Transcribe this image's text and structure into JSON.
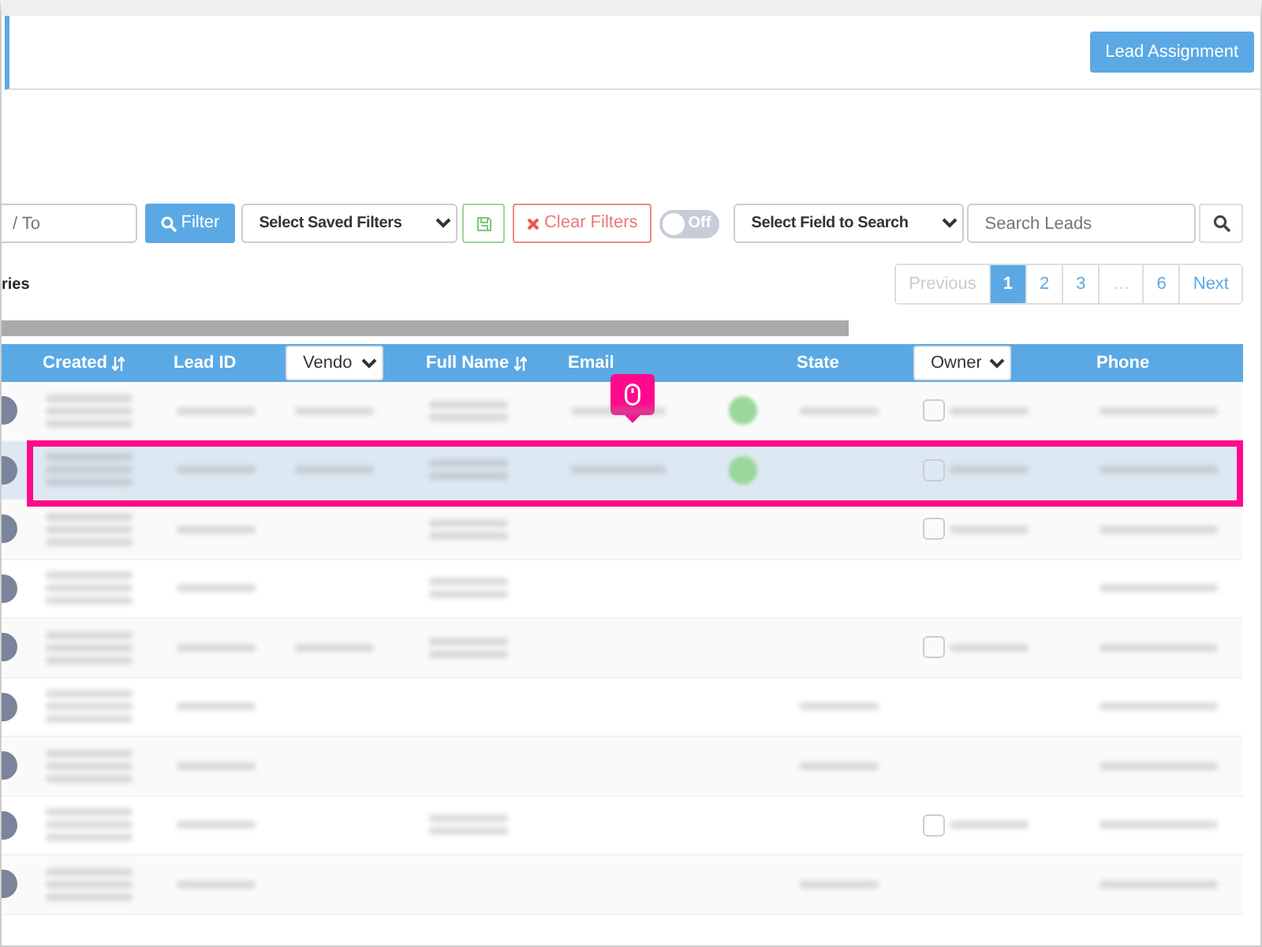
{
  "header": {
    "button": "Lead Assignment"
  },
  "filters": {
    "date_to": {
      "placeholder": "/ To"
    },
    "filter_button": "Filter",
    "saved_filters": "Select Saved Filters",
    "clear_button": "Clear Filters",
    "toggle": {
      "label": "Off",
      "on": false
    },
    "search_field": "Select Field to Search",
    "search": {
      "placeholder": "Search Leads"
    }
  },
  "entries_text": "ries",
  "pagination": [
    {
      "label": "Previous",
      "selected": false,
      "disabled": true
    },
    {
      "label": "1",
      "selected": true,
      "disabled": false
    },
    {
      "label": "2",
      "selected": false,
      "disabled": false
    },
    {
      "label": "3",
      "selected": false,
      "disabled": false
    },
    {
      "label": "…",
      "selected": false,
      "disabled": true
    },
    {
      "label": "6",
      "selected": false,
      "disabled": false
    },
    {
      "label": "Next",
      "selected": false,
      "disabled": false
    }
  ],
  "table": {
    "columns": [
      {
        "kind": "text",
        "label": "Created",
        "sortable": true
      },
      {
        "kind": "text",
        "label": "Lead ID",
        "sortable": false
      },
      {
        "kind": "select",
        "label": "Vendo"
      },
      {
        "kind": "text",
        "label": "Full Name",
        "sortable": true
      },
      {
        "kind": "text",
        "label": "Email",
        "sortable": false
      },
      {
        "kind": "blank"
      },
      {
        "kind": "text",
        "label": "State",
        "sortable": false
      },
      {
        "kind": "select",
        "label": "Owner"
      },
      {
        "kind": "text",
        "label": "Phone",
        "sortable": false
      }
    ],
    "rows": [
      {
        "selected": false,
        "highlighted": false,
        "cells": [
          {
            "kind": "blurred"
          },
          {
            "kind": "blurred"
          },
          {
            "kind": "blurred"
          },
          {
            "kind": "blurred"
          },
          {
            "kind": "blurred"
          },
          {
            "kind": "dot"
          },
          {
            "kind": "blurred"
          },
          {
            "kind": "owner"
          },
          {
            "kind": "blurred"
          }
        ]
      },
      {
        "selected": true,
        "highlighted": true,
        "cells": [
          {
            "kind": "blurred"
          },
          {
            "kind": "blurred"
          },
          {
            "kind": "blurred"
          },
          {
            "kind": "blurred"
          },
          {
            "kind": "blurred"
          },
          {
            "kind": "dot"
          },
          {
            "kind": "blank"
          },
          {
            "kind": "owner"
          },
          {
            "kind": "blurred"
          }
        ]
      },
      {
        "selected": false,
        "highlighted": false,
        "cells": [
          {
            "kind": "blurred"
          },
          {
            "kind": "blurred"
          },
          {
            "kind": "blank"
          },
          {
            "kind": "blurred"
          },
          {
            "kind": "blank"
          },
          {
            "kind": "blank"
          },
          {
            "kind": "blank"
          },
          {
            "kind": "owner"
          },
          {
            "kind": "blurred"
          }
        ]
      },
      {
        "selected": false,
        "highlighted": false,
        "cells": [
          {
            "kind": "blurred"
          },
          {
            "kind": "blurred"
          },
          {
            "kind": "blank"
          },
          {
            "kind": "blurred"
          },
          {
            "kind": "blank"
          },
          {
            "kind": "blank"
          },
          {
            "kind": "blank"
          },
          {
            "kind": "blank"
          },
          {
            "kind": "blurred"
          }
        ]
      },
      {
        "selected": false,
        "highlighted": false,
        "cells": [
          {
            "kind": "blurred"
          },
          {
            "kind": "blurred"
          },
          {
            "kind": "blurred"
          },
          {
            "kind": "blurred"
          },
          {
            "kind": "blank"
          },
          {
            "kind": "blank"
          },
          {
            "kind": "blank"
          },
          {
            "kind": "owner"
          },
          {
            "kind": "blurred"
          }
        ]
      },
      {
        "selected": false,
        "highlighted": false,
        "cells": [
          {
            "kind": "blurred"
          },
          {
            "kind": "blurred"
          },
          {
            "kind": "blank"
          },
          {
            "kind": "blank"
          },
          {
            "kind": "blank"
          },
          {
            "kind": "blank"
          },
          {
            "kind": "blurred"
          },
          {
            "kind": "blank"
          },
          {
            "kind": "blurred"
          }
        ]
      },
      {
        "selected": false,
        "highlighted": false,
        "cells": [
          {
            "kind": "blurred"
          },
          {
            "kind": "blurred"
          },
          {
            "kind": "blank"
          },
          {
            "kind": "blank"
          },
          {
            "kind": "blank"
          },
          {
            "kind": "blank"
          },
          {
            "kind": "blurred"
          },
          {
            "kind": "blank"
          },
          {
            "kind": "blurred"
          }
        ]
      },
      {
        "selected": false,
        "highlighted": false,
        "cells": [
          {
            "kind": "blurred"
          },
          {
            "kind": "blurred"
          },
          {
            "kind": "blank"
          },
          {
            "kind": "blurred"
          },
          {
            "kind": "blank"
          },
          {
            "kind": "blank"
          },
          {
            "kind": "blank"
          },
          {
            "kind": "owner"
          },
          {
            "kind": "blurred"
          }
        ]
      },
      {
        "selected": false,
        "highlighted": false,
        "cells": [
          {
            "kind": "blurred"
          },
          {
            "kind": "blurred"
          },
          {
            "kind": "blank"
          },
          {
            "kind": "blank"
          },
          {
            "kind": "blank"
          },
          {
            "kind": "blank"
          },
          {
            "kind": "blurred"
          },
          {
            "kind": "blank"
          },
          {
            "kind": "blurred"
          }
        ]
      }
    ]
  }
}
